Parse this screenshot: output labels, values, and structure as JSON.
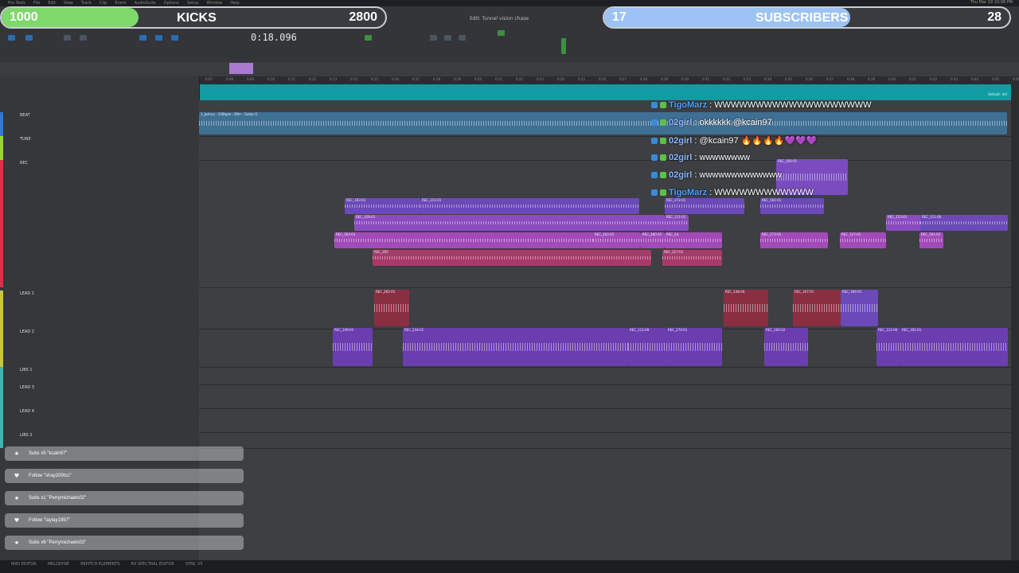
{
  "menubar": {
    "items": [
      "Pro Tools",
      "File",
      "Edit",
      "View",
      "Track",
      "Clip",
      "Event",
      "AudioSuite",
      "Options",
      "Setup",
      "Window",
      "Help"
    ],
    "clock": "Thu Mar 19 10:08 PM"
  },
  "transport": {
    "counter": "0:18.096",
    "edit_title": "Edit: Tunnel vision chase"
  },
  "kicks": {
    "left": "1000",
    "label": "KICKS",
    "right": "2800",
    "progress_fraction": 0.357
  },
  "subs": {
    "left": "17",
    "label": "SUBSCRIBERS",
    "right": "28",
    "progress_fraction": 0.607
  },
  "ruler": {
    "ticks": [
      "0:07",
      "0:08",
      "0:09",
      "0:10",
      "0:11",
      "0:12",
      "0:13",
      "0:14",
      "0:15",
      "0:16",
      "0:17",
      "0:18",
      "0:19",
      "0:20",
      "0:21",
      "0:22",
      "0:23",
      "0:24",
      "0:25",
      "0:26",
      "0:27",
      "0:28",
      "0:29",
      "0:30",
      "0:31",
      "0:32",
      "0:33",
      "0:34",
      "0:35",
      "0:36",
      "0:37",
      "0:38",
      "0:39",
      "0:40",
      "0:41",
      "0:42",
      "0:43",
      "0:44",
      "0:45",
      "0:46"
    ]
  },
  "marker_label": "Default: 4/4",
  "tracks": [
    {
      "name": "BEAT",
      "color": "#2c7bd9"
    },
    {
      "name": "TUNE",
      "color": "#9ad23a"
    },
    {
      "name": "REC",
      "color": "#d8324a"
    },
    {
      "name": "LEAD 1",
      "color": "#c8c83a"
    },
    {
      "name": "LEAD 2",
      "color": "#c8c83a"
    },
    {
      "name": "LIBS 1",
      "color": "#3ab7b0"
    },
    {
      "name": "LEAD 3",
      "color": "#3ab7b0"
    },
    {
      "name": "LEAD 4",
      "color": "#3ab7b0"
    },
    {
      "name": "LIBS 2",
      "color": "#3ab7b0"
    }
  ],
  "clips": {
    "beat": "1_Joshua - 158bpm - Dfm - Guitar G",
    "rec": [
      "REC_183-01",
      "REC_213-01",
      "REC_272-01",
      "REC_161-01",
      "REC_128-01",
      "REC_111-01",
      "REC_153-01",
      "REC_111-06",
      "REC_163-01",
      "REC_202-01",
      "REC_280-01",
      "REC_24",
      "REC_273-01",
      "REC_127-01",
      "REC_161-02",
      "REC_265",
      "REC_217-01",
      "REC_269-01",
      "REC_296-01"
    ],
    "lead1": [
      "REC_262-01",
      "REC_148-04",
      "REC_167-01",
      "REC_169-01"
    ],
    "lead2": [
      "REC_249-01",
      "REC_234-01",
      "REC_112-08",
      "REC_270-01",
      "REC_160-02",
      "REC_112-06",
      "REC_301-01"
    ],
    "db": "0 dB"
  },
  "chat": [
    {
      "user": "TigoMarz",
      "msg": "WWWWWWWWWWWWWWWWWWW",
      "color": "#4aa3ff"
    },
    {
      "user": "02girl",
      "msg": "okkkkkk @kcain97",
      "color": "#8ab8ff"
    },
    {
      "user": "02girl",
      "msg": "@kcain97 🔥🔥🔥🔥💜💜💜",
      "color": "#8ab8ff"
    },
    {
      "user": "02girl",
      "msg": "wwwwwwww",
      "color": "#8ab8ff"
    },
    {
      "user": "02girl",
      "msg": "wwwwwwwwwwwww",
      "color": "#8ab8ff"
    },
    {
      "user": "TigoMarz",
      "msg": "WWWWWWWWWWWW",
      "color": "#4aa3ff"
    }
  ],
  "alerts": [
    {
      "icon": "★",
      "text": "Subs x5 \"kcain97\""
    },
    {
      "icon": "♥",
      "text": "Follow \"shay200tcc\""
    },
    {
      "icon": "★",
      "text": "Subs x1 \"Perrymichaels02\""
    },
    {
      "icon": "♥",
      "text": "Follow \"laylay1997\""
    },
    {
      "icon": "★",
      "text": "Subs x6 \"Perrymichaels02\""
    }
  ],
  "bottombar": [
    "MIDI EDITOR",
    "MELODYNE",
    "REPITCH ELEMENTS",
    "RX SPECTRAL EDITOR",
    "SYNC VX"
  ]
}
